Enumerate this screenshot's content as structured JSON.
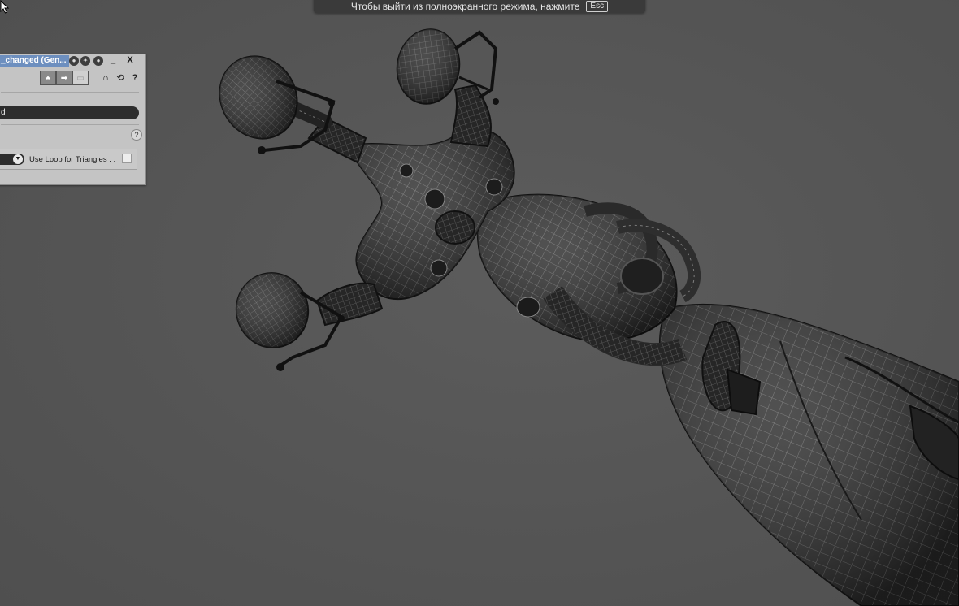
{
  "notification": {
    "text": "Чтобы выйти из полноэкранного режима, нажмите",
    "key": "Esc"
  },
  "panel": {
    "title": "_changed (Gen...",
    "buttons": {
      "minimize": "_",
      "close": "X"
    },
    "toolbar": {
      "segments": [
        "pin-icon",
        "move-icon",
        "rect-icon"
      ],
      "icons": [
        "magnet-icon",
        "symmetry-icon",
        "help-icon"
      ],
      "help_label": "?"
    },
    "mode_field": "d",
    "help_label": "?",
    "options": {
      "checkbox_label": "Use Loop for Triangles . .",
      "checked": false
    }
  },
  "viewport": {
    "object": "wireframe-robotic-arm",
    "background": "#575757",
    "wire_color": "#8a8a8a",
    "mesh_color": "#2a2a2a"
  }
}
